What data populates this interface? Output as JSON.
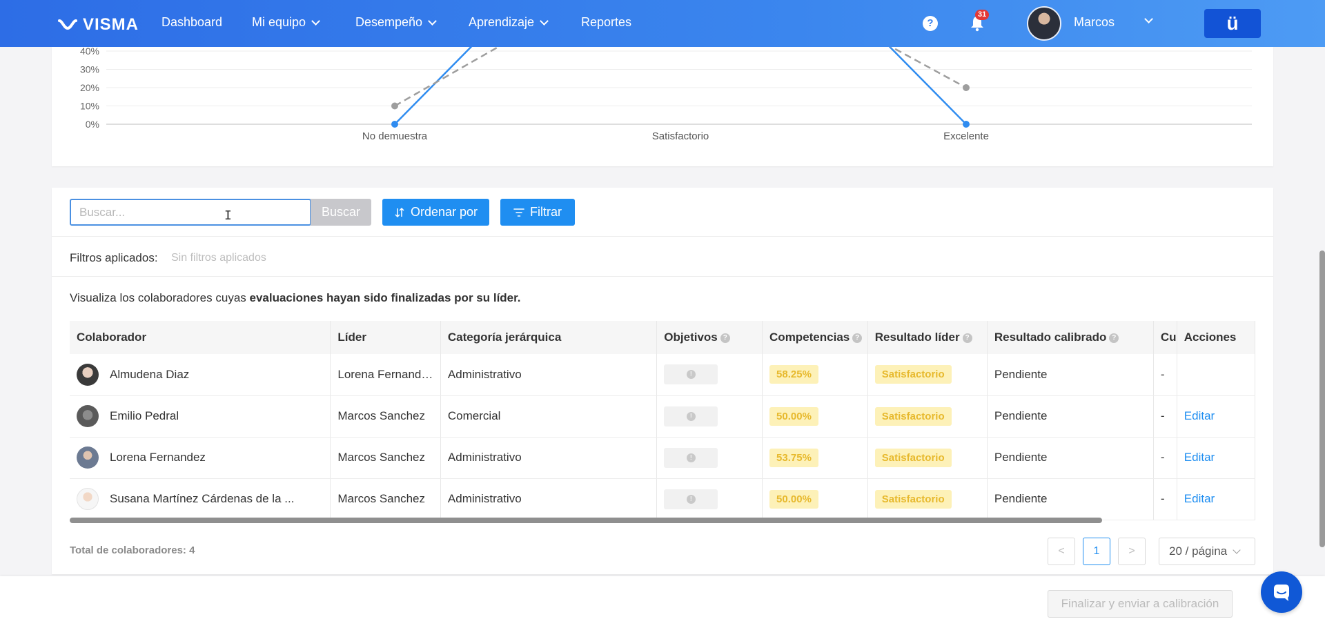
{
  "topbar": {
    "logo": "VISMA",
    "nav": [
      {
        "label": "Dashboard"
      },
      {
        "label": "Mi equipo"
      },
      {
        "label": "Desempeño"
      },
      {
        "label": "Aprendizaje"
      },
      {
        "label": "Reportes"
      }
    ],
    "help": "?",
    "notifications_count": "31",
    "user_name": "Marcos",
    "brand_button": "ü"
  },
  "chart_data": {
    "type": "line",
    "categories": [
      "No demuestra",
      "Satisfactorio",
      "Excelente"
    ],
    "y_tick_labels": [
      "0%",
      "10%",
      "20%",
      "30%",
      "40%"
    ],
    "ylim": [
      0,
      40
    ],
    "grid": true,
    "series": [
      {
        "style": "solid",
        "color": "#2f8cf0",
        "values": [
          0,
          null,
          0
        ]
      },
      {
        "style": "dashed",
        "color": "#9e9e9e",
        "values": [
          10,
          null,
          20
        ]
      }
    ]
  },
  "toolbar": {
    "search_placeholder": "Buscar...",
    "search_button": "Buscar",
    "sort_button": "Ordenar por",
    "filter_button": "Filtrar"
  },
  "filters": {
    "label": "Filtros aplicados:",
    "value": "Sin filtros aplicados"
  },
  "intro": {
    "prefix": "Visualiza los colaboradores cuyas ",
    "bold": "evaluaciones hayan sido finalizadas por su líder."
  },
  "table": {
    "headers": {
      "colaborador": "Colaborador",
      "lider": "Líder",
      "categoria": "Categoría jerárquica",
      "objetivos": "Objetivos",
      "competencias": "Competencias",
      "resultado_lider": "Resultado líder",
      "resultado_calibrado": "Resultado calibrado",
      "cu": "Cu",
      "acciones": "Acciones"
    },
    "rows": [
      {
        "colaborador": "Almudena Diaz",
        "lider": "Lorena Fernande...",
        "categoria": "Administrativo",
        "competencias": "58.25%",
        "resultado_lider": "Satisfactorio",
        "resultado_calibrado": "Pendiente",
        "cu": "-",
        "accion": ""
      },
      {
        "colaborador": "Emilio Pedral",
        "lider": "Marcos Sanchez",
        "categoria": "Comercial",
        "competencias": "50.00%",
        "resultado_lider": "Satisfactorio",
        "resultado_calibrado": "Pendiente",
        "cu": "-",
        "accion": "Editar"
      },
      {
        "colaborador": "Lorena Fernandez",
        "lider": "Marcos Sanchez",
        "categoria": "Administrativo",
        "competencias": "53.75%",
        "resultado_lider": "Satisfactorio",
        "resultado_calibrado": "Pendiente",
        "cu": "-",
        "accion": "Editar"
      },
      {
        "colaborador": "Susana Martínez Cárdenas de la ...",
        "lider": "Marcos Sanchez",
        "categoria": "Administrativo",
        "competencias": "50.00%",
        "resultado_lider": "Satisfactorio",
        "resultado_calibrado": "Pendiente",
        "cu": "-",
        "accion": "Editar"
      }
    ]
  },
  "pagination": {
    "total": "Total de colaboradores: 4",
    "prev": "<",
    "current": "1",
    "next": ">",
    "page_size": "20 / página"
  },
  "footer": {
    "finalize_button": "Finalizar y enviar a calibración"
  }
}
